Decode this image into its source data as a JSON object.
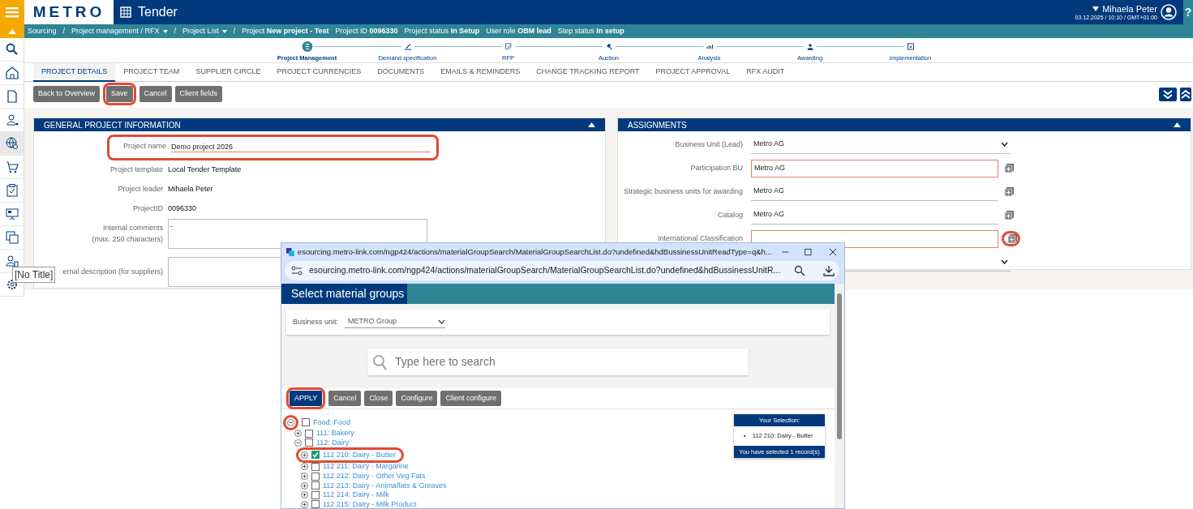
{
  "header": {
    "logo": "METRO",
    "app_title": "Tender",
    "user": "Mihaela Peter",
    "datetime": "03.12.2025 / 10:10 / GMT+01:00",
    "help": "?"
  },
  "breadcrumb": [
    {
      "text": "Sourcing",
      "dropdown": false,
      "separator": "/"
    },
    {
      "text": "Project management / RFX",
      "dropdown": true,
      "separator": "/"
    },
    {
      "text": "Project List",
      "dropdown": true,
      "separator": "/"
    }
  ],
  "status": [
    {
      "label": "Project",
      "value": "New project - Test"
    },
    {
      "label": "Project ID",
      "value": "0096330"
    },
    {
      "label": "Project status",
      "value": "In Setup"
    },
    {
      "label": "User role",
      "value": "OBM lead"
    },
    {
      "label": "Step status",
      "value": "In setup"
    }
  ],
  "sidebar": [
    {
      "selected": false
    },
    {
      "selected": false
    },
    {
      "selected": false
    },
    {
      "selected": false
    },
    {
      "selected": true
    },
    {
      "selected": false
    },
    {
      "selected": false
    },
    {
      "selected": false
    },
    {
      "selected": false
    },
    {
      "selected": false
    },
    {
      "selected": false
    }
  ],
  "steps": [
    {
      "label": "Project Management",
      "selected": true
    },
    {
      "label": "Demand specification",
      "selected": false
    },
    {
      "label": "RFP",
      "selected": false
    },
    {
      "label": "Auction",
      "selected": false
    },
    {
      "label": "Analysis",
      "selected": false
    },
    {
      "label": "Awarding",
      "selected": false
    },
    {
      "label": "Implementation",
      "selected": false
    }
  ],
  "tabs": [
    {
      "label": "PROJECT DETAILS",
      "selected": true
    },
    {
      "label": "PROJECT TEAM",
      "selected": false
    },
    {
      "label": "SUPPLIER CIRCLE",
      "selected": false
    },
    {
      "label": "PROJECT CURRENCIES",
      "selected": false
    },
    {
      "label": "DOCUMENTS",
      "selected": false
    },
    {
      "label": "EMAILS & REMINDERS",
      "selected": false
    },
    {
      "label": "CHANGE TRACKING REPORT",
      "selected": false
    },
    {
      "label": "PROJECT APPROVAL",
      "selected": false
    },
    {
      "label": "RFX AUDIT",
      "selected": false
    }
  ],
  "toolbar": [
    {
      "label": "Back to Overview",
      "highlighted": false
    },
    {
      "label": "Save",
      "highlighted": true
    },
    {
      "label": "Cancel",
      "highlighted": false
    },
    {
      "label": "Client fields",
      "highlighted": false
    }
  ],
  "general_panel": {
    "title": "GENERAL PROJECT INFORMATION",
    "fields": [
      {
        "kind": "input",
        "label": "Project name",
        "value": "Demo project 2026",
        "highlighted": true
      },
      {
        "kind": "static",
        "label": "Project template",
        "value": "Local Tender Template",
        "highlighted": false
      },
      {
        "kind": "static",
        "label": "Project leader",
        "value": "Mihaela Peter",
        "highlighted": false
      },
      {
        "kind": "static",
        "label": "ProjectID",
        "value": "0096330",
        "highlighted": false
      },
      {
        "kind": "textarea",
        "label": "Internal comments\n(max. 250 characters)",
        "value": "-",
        "highlighted": false
      },
      {
        "kind": "textarea",
        "label": "ernal description (for suppliers)",
        "highlighted": false
      }
    ]
  },
  "assignments_panel": {
    "title": "ASSIGNMENTS",
    "fields": [
      {
        "kind": "select",
        "label": "Business Unit (Lead)",
        "value": "Metro AG",
        "required": false,
        "highlighted": false
      },
      {
        "kind": "multi",
        "label": "Participation BU",
        "value": "Metro AG",
        "required": true,
        "highlighted": false
      },
      {
        "kind": "multi",
        "label": "Strategic business units for awarding",
        "value": "Metro AG",
        "required": false,
        "highlighted": false
      },
      {
        "kind": "multi",
        "label": "Catalog",
        "value": "Metro AG",
        "required": false,
        "highlighted": false
      },
      {
        "kind": "multi",
        "label": "International Classification",
        "required": true,
        "highlighted": true
      },
      {
        "kind": "select",
        "required": false,
        "highlighted": false
      }
    ]
  },
  "tooltip": "[No Title]",
  "popup": {
    "window_title": "esourcing.metro-link.com/ngp424/actions/materialGroupSearch/MaterialGroupSearchList.do?undefined&hdBussinessUnitReadType=q&h...",
    "address": "esourcing.metro-link.com/ngp424/actions/materialGroupSearch/MaterialGroupSearchList.do?undefined&hdBussinessUnitR...",
    "heading": "Select material groups",
    "business_unit": {
      "label": "Business unit:",
      "value": "METRO Group"
    },
    "search": {
      "placeholder": "Type here to search"
    },
    "buttons": [
      {
        "label": "APPLY",
        "kind": "primary",
        "highlighted": true
      },
      {
        "label": "Cancel",
        "kind": "secondary",
        "highlighted": false
      },
      {
        "label": "Close",
        "kind": "secondary",
        "highlighted": false
      },
      {
        "label": "Configure",
        "kind": "secondary",
        "highlighted": false
      },
      {
        "label": "Client configure",
        "kind": "secondary",
        "highlighted": false
      }
    ],
    "tree": [
      {
        "label": "Food: Food",
        "expanded": true,
        "checked": false,
        "highlighted": true,
        "children": [
          {
            "label": "111: Bakery",
            "expanded": false,
            "checked": false,
            "highlighted": false
          },
          {
            "label": "112: Dairy",
            "expanded": true,
            "checked": false,
            "highlighted": false,
            "children": [
              {
                "label": "112 210: Dairy - Butter",
                "expanded": false,
                "checked": true,
                "highlighted": true
              },
              {
                "label": "112 211: Dairy - Margarine",
                "expanded": false,
                "checked": false,
                "highlighted": false
              },
              {
                "label": "112 212: Dairy - Other Veg Fats",
                "expanded": false,
                "checked": false,
                "highlighted": false
              },
              {
                "label": "112 213: Dairy - Animalfats & Greaves",
                "expanded": false,
                "checked": false,
                "highlighted": false
              },
              {
                "label": "112 214: Dairy - Milk",
                "expanded": false,
                "checked": false,
                "highlighted": false
              },
              {
                "label": "112 215: Dairy - Milk Product",
                "expanded": false,
                "checked": false,
                "highlighted": false
              }
            ]
          }
        ]
      }
    ],
    "selection": {
      "title": "Your Selection:",
      "items": [
        {
          "bullet": "•",
          "text": "112 210: Dairy - Butter"
        }
      ],
      "footer": "You have selected 1 record(s)"
    }
  }
}
